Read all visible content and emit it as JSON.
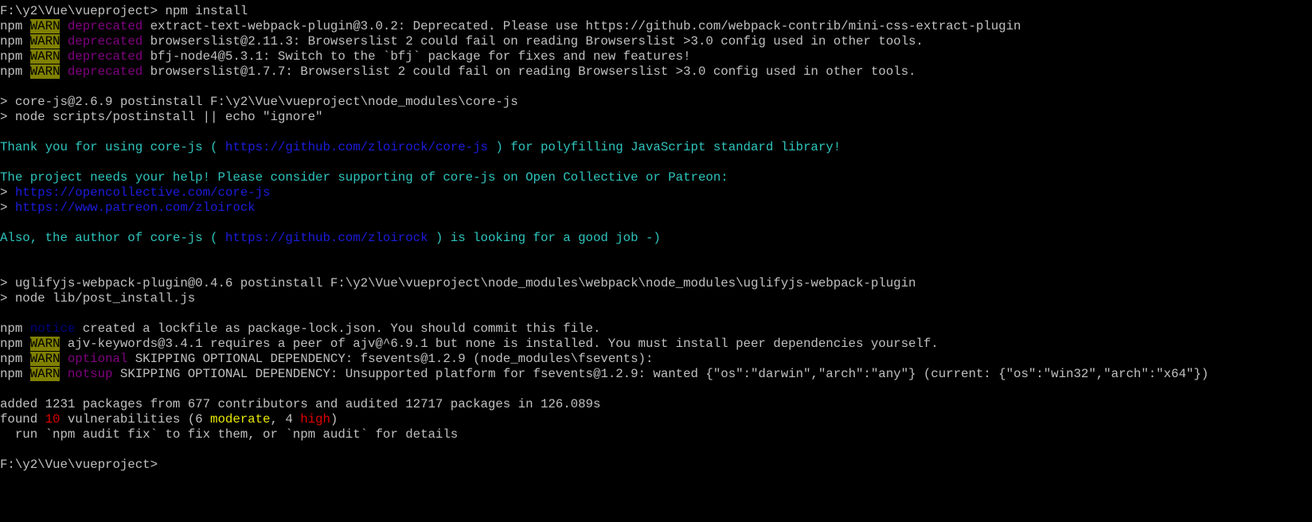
{
  "colors": {
    "warn_bg": "#808000",
    "deprecated": "#800080",
    "notice": "#000080",
    "info_cyan": "#2ec4bc",
    "link_blue": "#1c1cdc",
    "high_red": "#e00000",
    "moderate_yellow": "#e8e800",
    "text": "#c0c0c0",
    "background": "#000000"
  },
  "lines": [
    [
      [
        "F:\\y2\\Vue\\vueproject> npm install",
        "gray"
      ]
    ],
    [
      [
        "npm ",
        "gray"
      ],
      [
        "WARN",
        "warn"
      ],
      [
        " ",
        "gray"
      ],
      [
        "deprecated",
        "dep"
      ],
      [
        " extract-text-webpack-plugin@3.0.2: Deprecated. Please use https://github.com/webpack-contrib/mini-css-extract-plugin",
        "gray"
      ]
    ],
    [
      [
        "npm ",
        "gray"
      ],
      [
        "WARN",
        "warn"
      ],
      [
        " ",
        "gray"
      ],
      [
        "deprecated",
        "dep"
      ],
      [
        " browserslist@2.11.3: Browserslist 2 could fail on reading Browserslist >3.0 config used in other tools.",
        "gray"
      ]
    ],
    [
      [
        "npm ",
        "gray"
      ],
      [
        "WARN",
        "warn"
      ],
      [
        " ",
        "gray"
      ],
      [
        "deprecated",
        "dep"
      ],
      [
        " bfj-node4@5.3.1: Switch to the `bfj` package for fixes and new features!",
        "gray"
      ]
    ],
    [
      [
        "npm ",
        "gray"
      ],
      [
        "WARN",
        "warn"
      ],
      [
        " ",
        "gray"
      ],
      [
        "deprecated",
        "dep"
      ],
      [
        " browserslist@1.7.7: Browserslist 2 could fail on reading Browserslist >3.0 config used in other tools.",
        "gray"
      ]
    ],
    [],
    [
      [
        "> core-js@2.6.9 postinstall F:\\y2\\Vue\\vueproject\\node_modules\\core-js",
        "gray"
      ]
    ],
    [
      [
        "> node scripts/postinstall || echo \"ignore\"",
        "gray"
      ]
    ],
    [],
    [
      [
        "Thank you for using core-js ( ",
        "cyan"
      ],
      [
        "https://github.com/zloirock/core-js",
        "link"
      ],
      [
        " ) for polyfilling JavaScript standard library!",
        "cyan"
      ]
    ],
    [],
    [
      [
        "The project needs your help! Please consider supporting of core-js on Open Collective or Patreon:",
        "cyan"
      ]
    ],
    [
      [
        "> ",
        "gray"
      ],
      [
        "https://opencollective.com/core-js",
        "link"
      ]
    ],
    [
      [
        "> ",
        "gray"
      ],
      [
        "https://www.patreon.com/zloirock",
        "link"
      ]
    ],
    [],
    [
      [
        "Also, the author of core-js ( ",
        "cyan"
      ],
      [
        "https://github.com/zloirock",
        "link"
      ],
      [
        " ) is looking for a good job -)",
        "cyan"
      ]
    ],
    [],
    [],
    [
      [
        "> uglifyjs-webpack-plugin@0.4.6 postinstall F:\\y2\\Vue\\vueproject\\node_modules\\webpack\\node_modules\\uglifyjs-webpack-plugin",
        "gray"
      ]
    ],
    [
      [
        "> node lib/post_install.js",
        "gray"
      ]
    ],
    [],
    [
      [
        "npm ",
        "gray"
      ],
      [
        "notice",
        "notice"
      ],
      [
        " created a lockfile as package-lock.json. You should commit this file.",
        "gray"
      ]
    ],
    [
      [
        "npm ",
        "gray"
      ],
      [
        "WARN",
        "warn"
      ],
      [
        " ajv-keywords@3.4.1 requires a peer of ajv@^6.9.1 but none is installed. You must install peer dependencies yourself.",
        "gray"
      ]
    ],
    [
      [
        "npm ",
        "gray"
      ],
      [
        "WARN",
        "warn"
      ],
      [
        " ",
        "gray"
      ],
      [
        "optional",
        "dep"
      ],
      [
        " SKIPPING OPTIONAL DEPENDENCY: fsevents@1.2.9 (node_modules\\fsevents):",
        "gray"
      ]
    ],
    [
      [
        "npm ",
        "gray"
      ],
      [
        "WARN",
        "warn"
      ],
      [
        " ",
        "gray"
      ],
      [
        "notsup",
        "dep"
      ],
      [
        " SKIPPING OPTIONAL DEPENDENCY: Unsupported platform for fsevents@1.2.9: wanted {\"os\":\"darwin\",\"arch\":\"any\"} (current: {\"os\":\"win32\",\"arch\":\"x64\"})",
        "gray"
      ]
    ],
    [],
    [
      [
        "added 1231 packages from 677 contributors and audited 12717 packages in 126.089s",
        "gray"
      ]
    ],
    [
      [
        "found ",
        "gray"
      ],
      [
        "10",
        "red"
      ],
      [
        " vulnerabilities (6 ",
        "gray"
      ],
      [
        "moderate",
        "yellow"
      ],
      [
        ", 4 ",
        "gray"
      ],
      [
        "high",
        "red"
      ],
      [
        ")",
        "gray"
      ]
    ],
    [
      [
        "  run `npm audit fix` to fix them, or `npm audit` for details",
        "gray"
      ]
    ],
    [],
    [
      [
        "F:\\y2\\Vue\\vueproject>",
        "gray"
      ]
    ]
  ]
}
